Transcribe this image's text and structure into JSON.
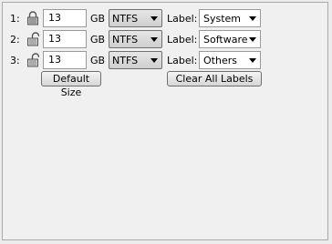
{
  "partitions": [
    {
      "number": "1:",
      "lock_icon": "lock-closed-icon",
      "size": "13",
      "unit": "GB",
      "filesystem": "NTFS",
      "label_caption": "Label:",
      "label": "System"
    },
    {
      "number": "2:",
      "lock_icon": "lock-open-icon",
      "size": "13",
      "unit": "GB",
      "filesystem": "NTFS",
      "label_caption": "Label:",
      "label": "Software"
    },
    {
      "number": "3:",
      "lock_icon": "lock-open-icon",
      "size": "13",
      "unit": "GB",
      "filesystem": "NTFS",
      "label_caption": "Label:",
      "label": "Others"
    }
  ],
  "buttons": {
    "default_size": "Default Size",
    "clear_labels": "Clear All Labels"
  }
}
